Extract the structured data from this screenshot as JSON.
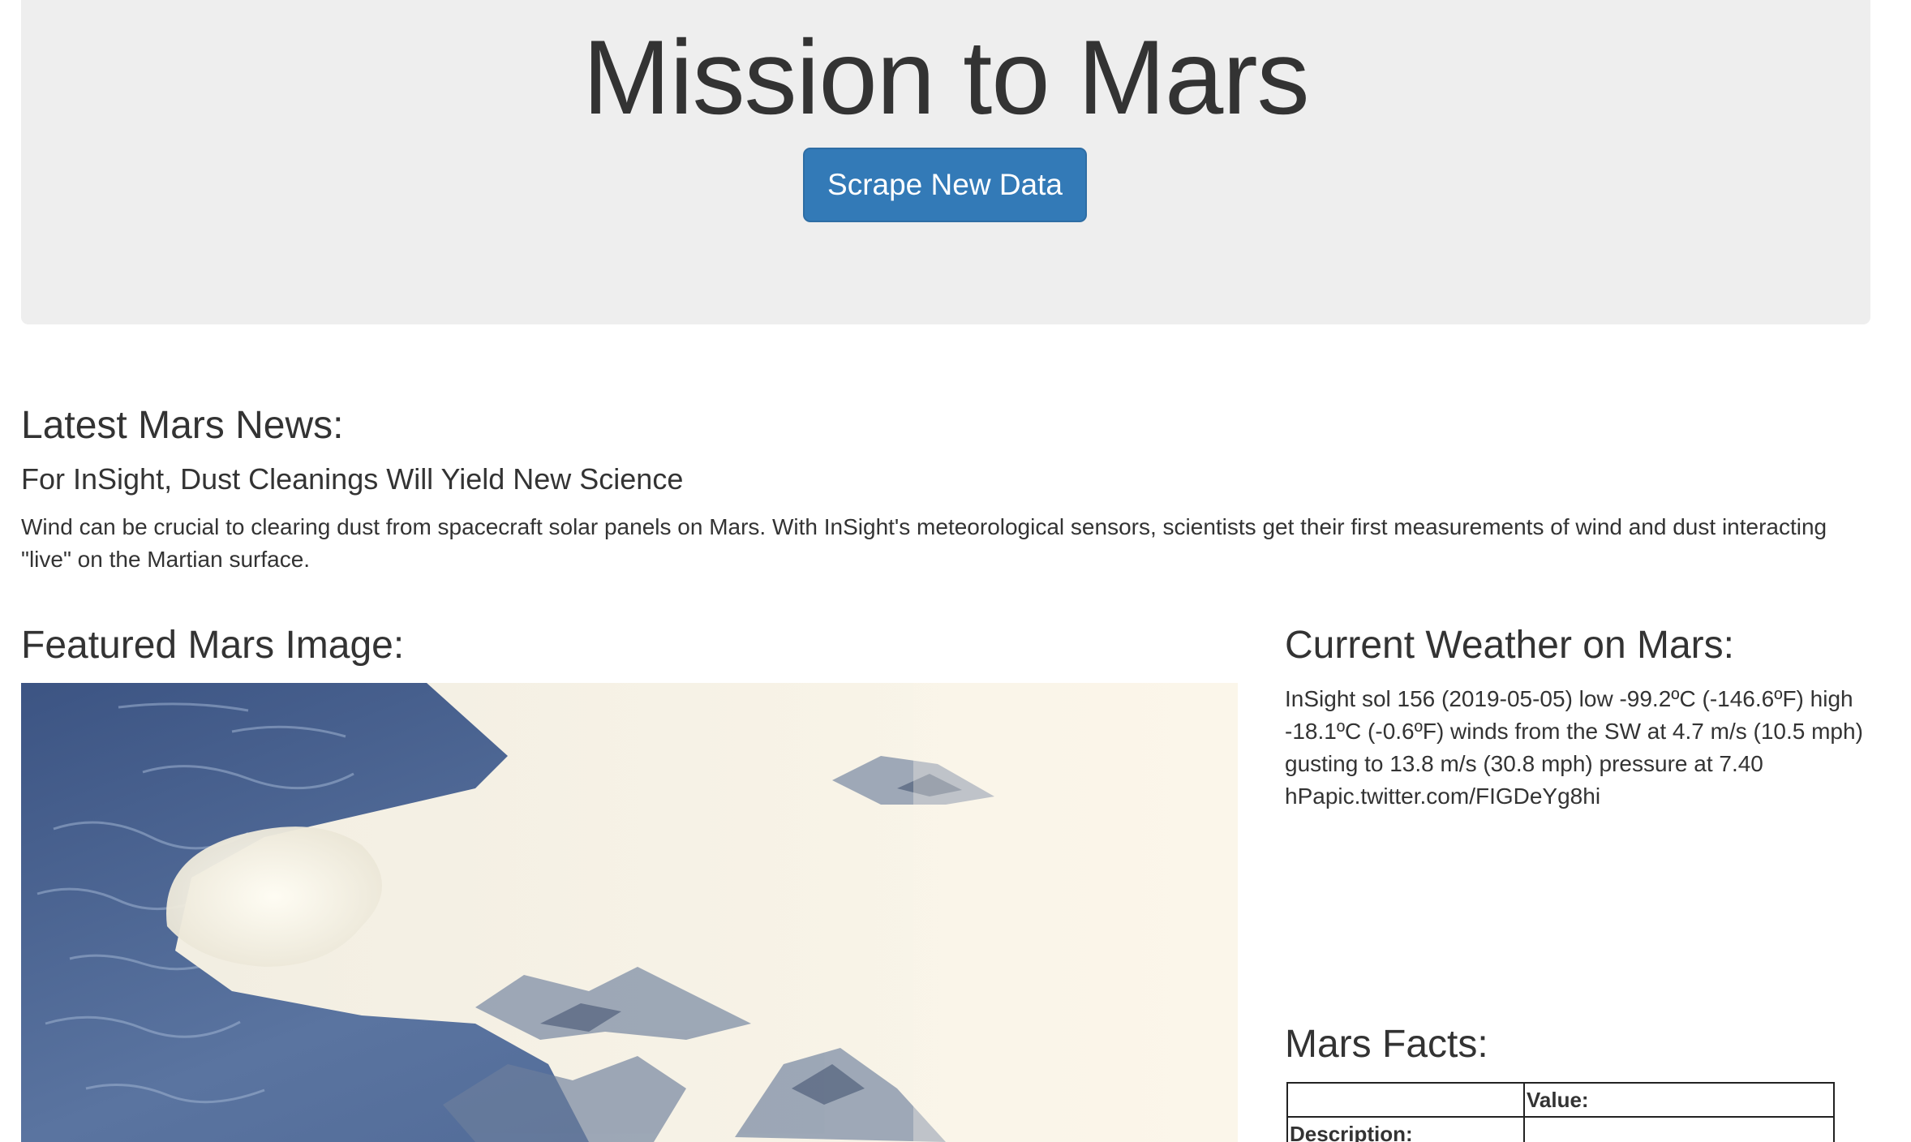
{
  "header": {
    "title": "Mission to Mars",
    "scrape_button": "Scrape New Data",
    "colors": {
      "jumbotron_bg": "#eeeeee",
      "button_bg": "#337ab7"
    }
  },
  "news": {
    "heading": "Latest Mars News:",
    "title": "For InSight, Dust Cleanings Will Yield New Science",
    "paragraph": "Wind can be crucial to clearing dust from spacecraft solar panels on Mars. With InSight's meteorological sensors, scientists get their first measurements of wind and dust interacting \"live\" on the Martian surface."
  },
  "featured": {
    "heading": "Featured Mars Image:",
    "image_icon": "aerial-glacier-photo"
  },
  "weather": {
    "heading": "Current Weather on Mars:",
    "text": "InSight sol 156 (2019-05-05) low -99.2ºC (-146.6ºF) high -18.1ºC (-0.6ºF) winds from the SW at 4.7 m/s (10.5 mph) gusting to 13.8 m/s (30.8 mph) pressure at 7.40 hPapic.twitter.com/FIGDeYg8hi"
  },
  "facts": {
    "heading": "Mars Facts:",
    "header_row": [
      "",
      "Value:"
    ],
    "rows": [
      [
        "Description:",
        ""
      ]
    ]
  }
}
